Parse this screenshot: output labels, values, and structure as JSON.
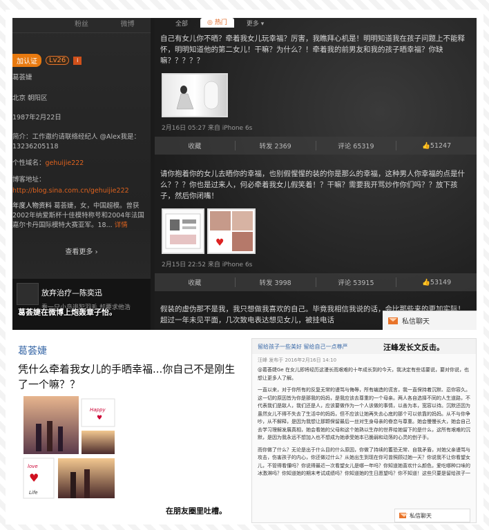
{
  "left": {
    "tabs": [
      "",
      "粉丝",
      "微博"
    ],
    "verified_label": "加认证",
    "level": "Lv26",
    "level_icon": "i",
    "name": "葛荟婕",
    "location": "北京 朝阳区",
    "birthday": "1987年2月22日",
    "intro_label": "简介：",
    "intro_text": "工作邀约请联络经纪人 @Alex我是：",
    "intro_phone": "13236205118",
    "domain_label": "个性域名：",
    "domain": "gehuijie222",
    "blog_label": "博客地址：",
    "blog_url": "http://blog.sina.com.cn/gehuijie222",
    "bio_bold": "年度人物资料",
    "bio_text": "葛荟婕，女，中国超模。曾获2002年纳爱斯杯十佳模特称号和2004年法国嘉尔卡丹国际模特大赛亚军。18...",
    "bio_more": "详情",
    "see_more": "查看更多 ›",
    "bottom_title": "放弃治疗—陈奕迅",
    "bottom_sub": "看一只小鸟逃犯羽毛 却要求他浩",
    "caption": "葛荟婕在微博上炮轰章子怡。"
  },
  "right": {
    "tabs": [
      {
        "label": "全部",
        "active": false
      },
      {
        "label": "热门",
        "active": true
      },
      {
        "label": "更多 ▾",
        "active": false
      }
    ],
    "posts": [
      {
        "text": "自己有女儿你不晒？牵着我女儿玩幸福？厉害，我瞧拜心机是！明明知道我在孩子问题上不能释怀，明明知道他的第二女儿！干嘛？为什么？！牵着我的前男友和我的孩子晒幸福？你缺嘛？？？？？",
        "meta": "2月16日 05:27 来自 iPhone 6s",
        "actions": [
          "收藏",
          "转发 2369",
          "评论 65319",
          "51247"
        ]
      },
      {
        "text": "请你抱着你的女儿去晒你的幸福，也别假惺惺的装的你是那么的幸福，这种男人你幸福的点是什么？？？你也是过来人，何必牵着我女儿假笑着！？干嘛？需要我开骂炒作你们吗？？放下孩子，然后你闭嘴！",
        "meta": "2月15日 22:52 来自 iPhone 6s",
        "actions": [
          "收藏",
          "转发 3998",
          "评论 53915",
          "53149"
        ]
      }
    ],
    "third_post_text": "假装的虚伪那不是我，我只想做我喜欢的自己。毕竟我相信我说的话，会比那些来的更加实际！超过一年未见平面，几次致电表达想见女儿，被挂电话",
    "dm_label": "私信聊天"
  },
  "bottom_left": {
    "name": "葛荟婕",
    "text": "凭什么牵着我女儿的手晒幸福...你自己不是刚生了一个嘛？？",
    "caption": "在朋友圈里吐槽。"
  },
  "bottom_right": {
    "title": "留给孩子一些美好 留给自己一点尊严",
    "caption": "汪峰发长文反击。",
    "meta": "汪峰 发布于 2016年2月16日 14:10",
    "paragraphs": [
      "@葛荟婕Ge 在女儿即将经历这漫长而艰难的十年成长到的今天，我决定有些话要说，要对你说，也想让更多人了解。",
      "一直以来，对于你所有的反复无常的谩骂与侮辱，所有编造的谎言，我一直保持着沉默、忍你容久。这一切的原因皆为你是那我的妈妈，是我应该去尊重的一个母亲。两人各自选择不同的人生道路，不代表我们是敌人，我们还是人，应该要做作为一个人该做的事情，以善为本，宽容以待。沉默还因为虽然女儿不得不失去了生活中的妈妈，但不应该让她再失去心底的那个可以依靠的妈妈。从不与你争吵，从不解释，是因为我想让那颗保留最后一丝对生身母亲的眷恋与尊重。她会慢慢长大，她会自己去学习理解发展真相，她会看她的父母和这个她熟以生存的世界给她留下的是什么，这所有艰难的沉默，是因为我永远不想加入也不想成为她承受她本已脆弱和动荡的心灵的刽子手。",
      "而你做了什么？无论是出于什么目的什么原因，你做了持续的蓄恐无常、自我矛盾，对她父亲谩骂与攻击，伤害孩子的内心，你还做过什么？从她出生到现在你可曾照顾过她一天？你说我不让你看望女儿，不管得看懂吗？你说得最近一次看望女儿是哪一年吗？你知道她喜欢什么颜色，爱吃哪种口味的冰激淋吗？你知道她的期末考试成绩吗？你知道她的生日愿望吗？你不知道！这些只要是留给孩子一"
    ],
    "dm_label": "私信聊天"
  }
}
